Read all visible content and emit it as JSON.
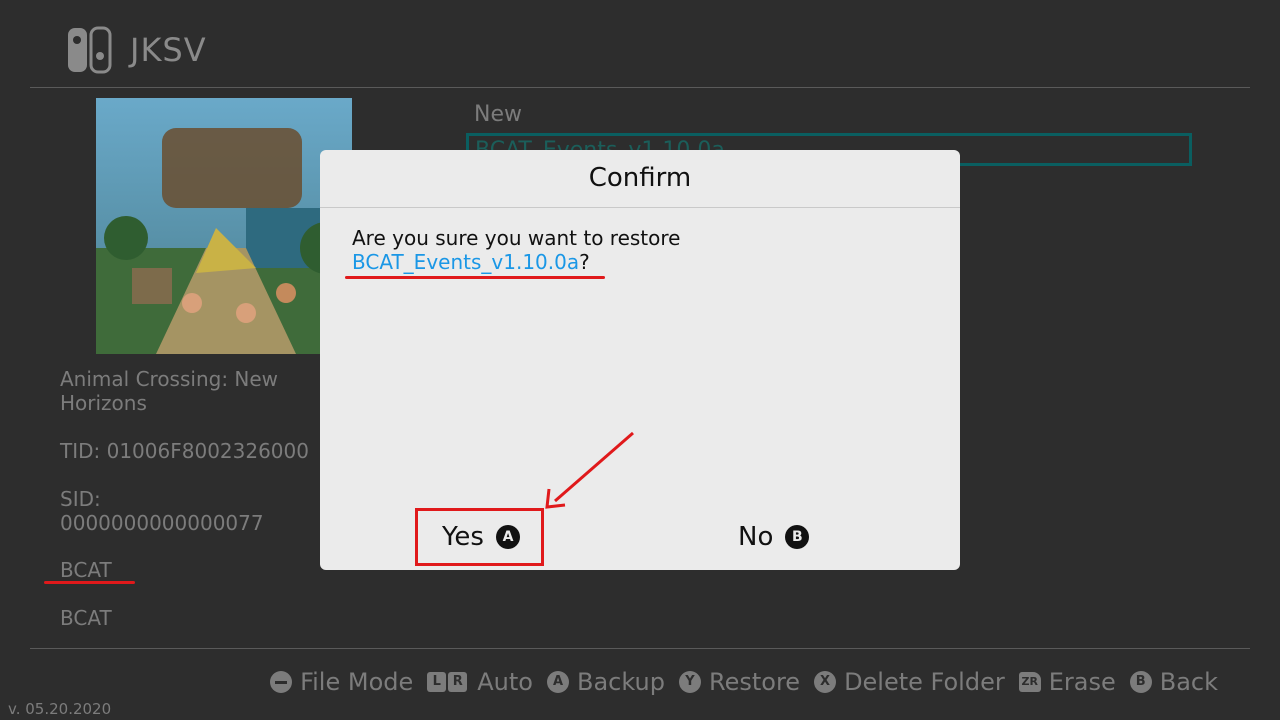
{
  "header": {
    "title": "JKSV",
    "icon": "switch-console-icon"
  },
  "game": {
    "cover_icon": "game-cover-art",
    "name": "Animal Crossing: New Horizons",
    "tid": "TID: 01006F8002326000",
    "sid_label": "SID:",
    "sid_value": "0000000000000077",
    "save_type_1": "BCAT",
    "save_type_2": "BCAT"
  },
  "folder_list": {
    "items": [
      "New",
      "BCAT_Events_v1.10.0a"
    ],
    "selected_index": 1
  },
  "dialog": {
    "title": "Confirm",
    "message_prefix": "Are you sure you want to restore",
    "message_file": "BCAT_Events_v1.10.0a",
    "message_suffix": "?",
    "yes_label": "Yes",
    "yes_button_glyph": "A",
    "no_label": "No",
    "no_button_glyph": "B"
  },
  "hints": {
    "file_mode": "File Mode",
    "auto": "Auto",
    "backup": "Backup",
    "restore": "Restore",
    "delete_folder": "Delete Folder",
    "erase": "Erase",
    "back": "Back",
    "icons": {
      "minus": "minus-button-icon",
      "lr": "lr-buttons-icon",
      "a": "A",
      "y": "Y",
      "x": "X",
      "zr": "ZR",
      "b": "B"
    }
  },
  "version": "v. 05.20.2020",
  "colors": {
    "background": "#2d2d2d",
    "dialog_bg": "#ebebeb",
    "highlight_border": "#0a5e60",
    "link_blue": "#1a97e6",
    "annotation_red": "#e0191b"
  }
}
